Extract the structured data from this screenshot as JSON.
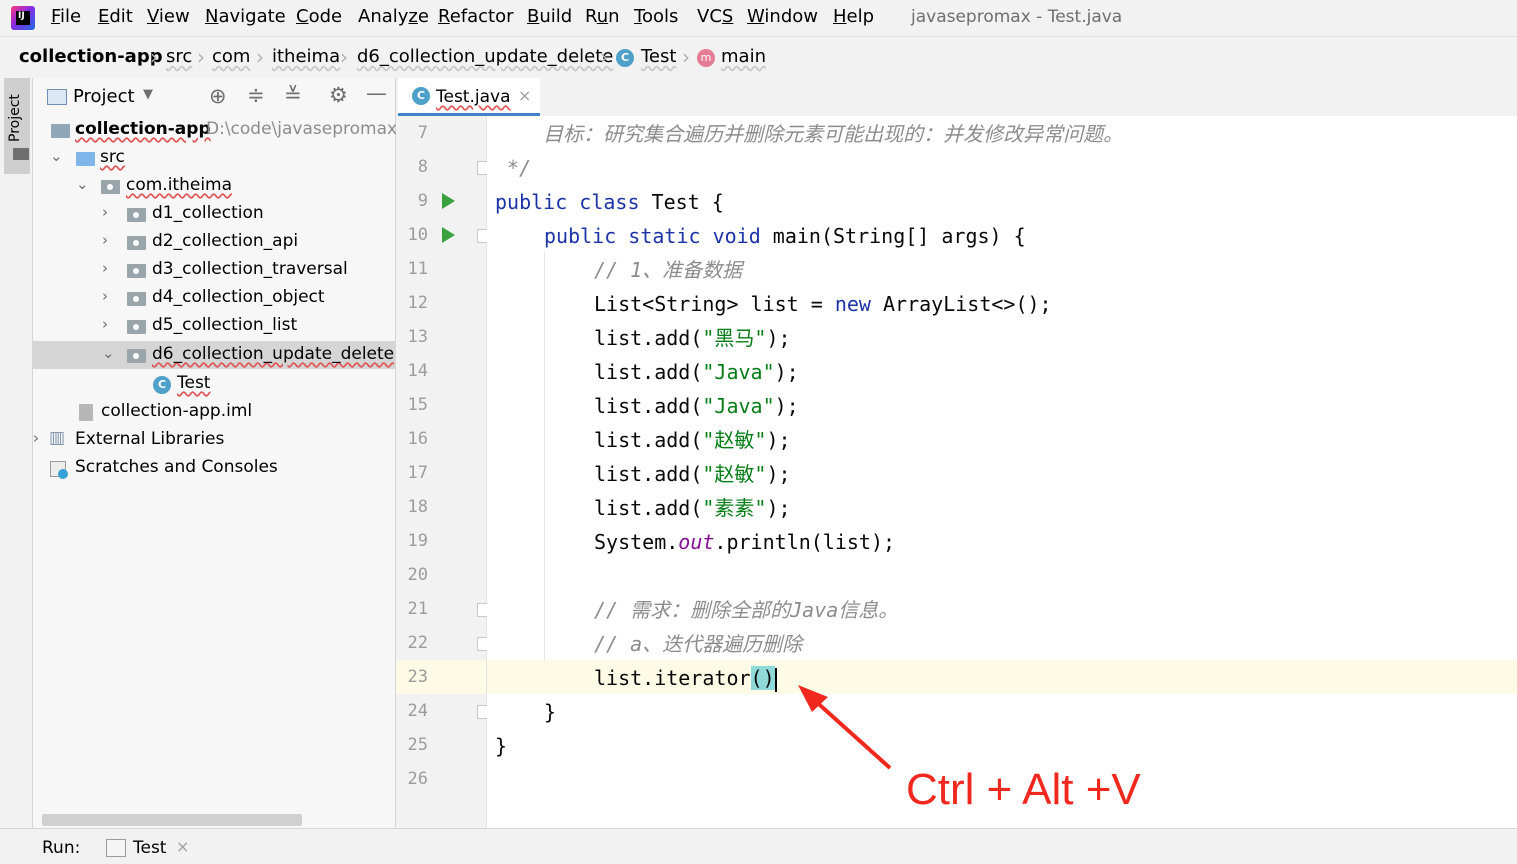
{
  "menubar": {
    "logo": "IJ",
    "items": [
      {
        "pre": "",
        "u": "F",
        "post": "ile"
      },
      {
        "pre": "",
        "u": "E",
        "post": "dit"
      },
      {
        "pre": "",
        "u": "V",
        "post": "iew"
      },
      {
        "pre": "",
        "u": "N",
        "post": "avigate"
      },
      {
        "pre": "",
        "u": "C",
        "post": "ode"
      },
      {
        "pre": "Analy",
        "u": "z",
        "post": "e"
      },
      {
        "pre": "",
        "u": "R",
        "post": "efactor"
      },
      {
        "pre": "",
        "u": "B",
        "post": "uild"
      },
      {
        "pre": "R",
        "u": "u",
        "post": "n"
      },
      {
        "pre": "",
        "u": "T",
        "post": "ools"
      },
      {
        "pre": "VC",
        "u": "S",
        "post": ""
      },
      {
        "pre": "",
        "u": "W",
        "post": "indow"
      },
      {
        "pre": "",
        "u": "H",
        "post": "elp"
      }
    ],
    "title": "javasepromax - Test.java"
  },
  "breadcrumb": [
    "collection-app",
    "src",
    "com",
    "itheima",
    "d6_collection_update_delete",
    "Test",
    "main"
  ],
  "breadcrumb_icons": {
    "class_letter": "C",
    "method_letter": "m"
  },
  "leftstrip": {
    "project_tab": "Project"
  },
  "project": {
    "header": "Project",
    "root": {
      "name": "collection-app",
      "path": "D:\\code\\javasepromax\\"
    },
    "tree": {
      "src": "src",
      "package": "com.itheima",
      "folders": [
        "d1_collection",
        "d2_collection_api",
        "d3_collection_traversal",
        "d4_collection_object",
        "d5_collection_list",
        "d6_collection_update_delete"
      ],
      "class": "Test",
      "iml": "collection-app.iml",
      "ext_libs": "External Libraries",
      "scratches": "Scratches and Consoles"
    }
  },
  "editor": {
    "tab": "Test.java",
    "lines": [
      {
        "n": "7"
      },
      {
        "n": "8"
      },
      {
        "n": "9"
      },
      {
        "n": "10"
      },
      {
        "n": "11"
      },
      {
        "n": "12"
      },
      {
        "n": "13"
      },
      {
        "n": "14"
      },
      {
        "n": "15"
      },
      {
        "n": "16"
      },
      {
        "n": "17"
      },
      {
        "n": "18"
      },
      {
        "n": "19"
      },
      {
        "n": "20"
      },
      {
        "n": "21"
      },
      {
        "n": "22"
      },
      {
        "n": "23"
      },
      {
        "n": "24"
      },
      {
        "n": "25"
      },
      {
        "n": "26"
      }
    ],
    "code": {
      "l7": "    目标：研究集合遍历并删除元素可能出现的：并发修改异常问题。",
      "l8": " */",
      "l9_kw1": "public",
      "l9_kw2": "class",
      "l9_rest": " Test {",
      "l10_kw1": "public",
      "l10_kw2": "static",
      "l10_kw3": "void",
      "l10_rest": " main(String[] args) {",
      "l11": "// 1、准备数据",
      "l12_a": "List<String> list = ",
      "l12_kw": "new",
      "l12_b": " ArrayList<>();",
      "add_prefix": "list.add(",
      "add_suffix": ");",
      "strings": [
        "\"黑马\"",
        "\"Java\"",
        "\"Java\"",
        "\"赵敏\"",
        "\"赵敏\"",
        "\"素素\""
      ],
      "l19_a": "System.",
      "l19_fld": "out",
      "l19_b": ".println(list);",
      "l21": "// 需求：删除全部的Java信息。",
      "l22": "// a、迭代器遍历删除",
      "l23_a": "list.iterator",
      "l23_paren": "()",
      "l24": "}",
      "l25": "}"
    }
  },
  "bottom": {
    "run_label": "Run:",
    "tab": "Test"
  },
  "annotation": {
    "text": "Ctrl + Alt +V",
    "color": "#f0281e"
  }
}
